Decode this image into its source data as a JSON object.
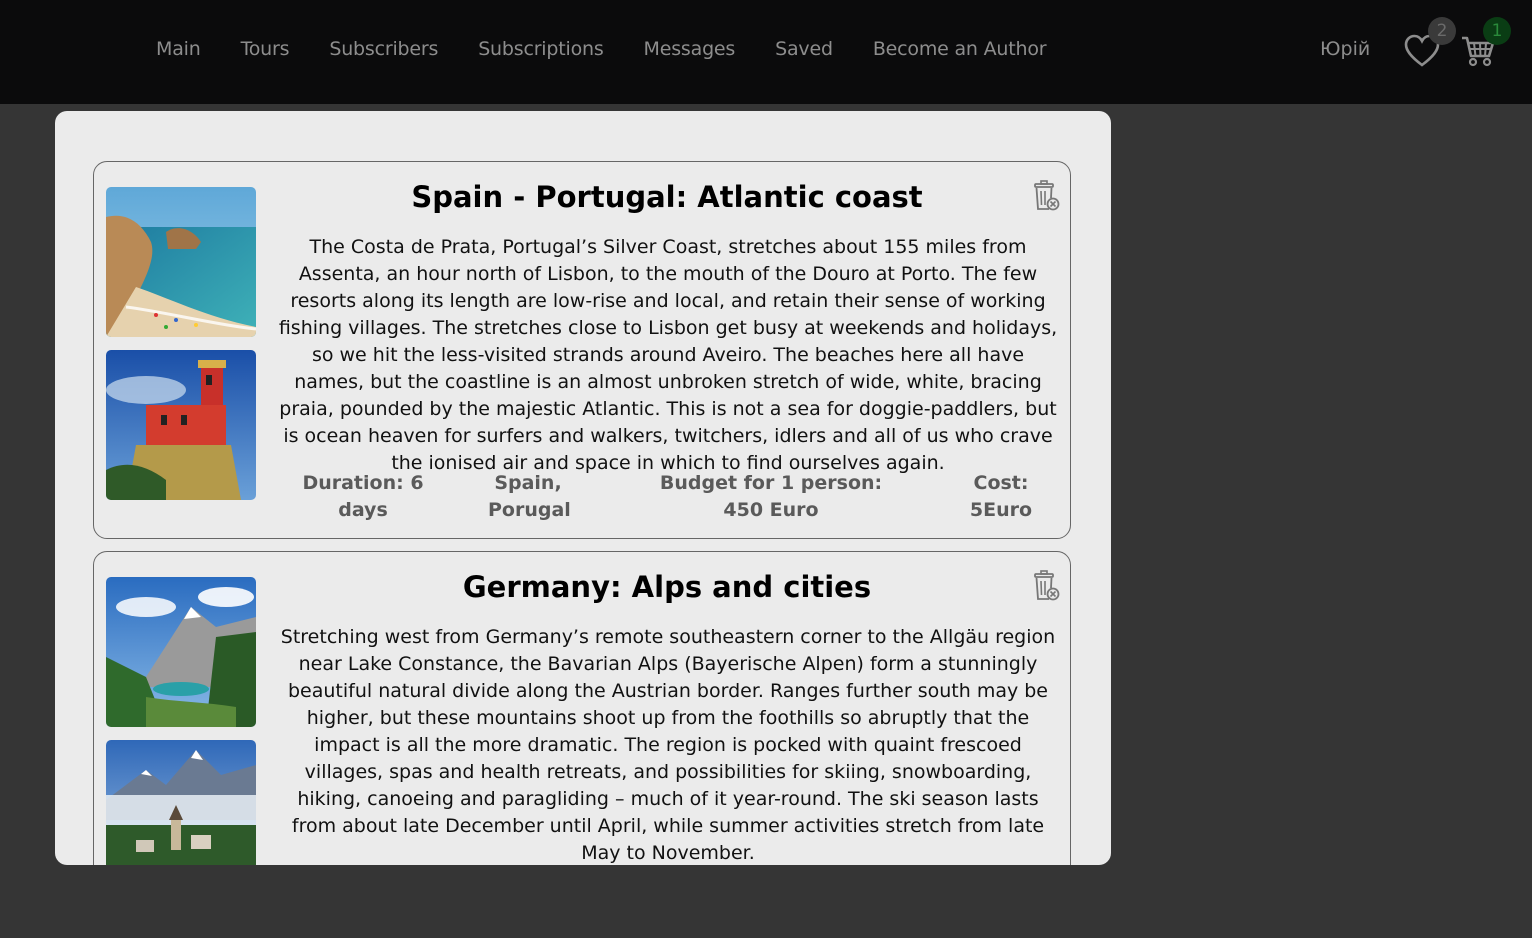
{
  "nav": {
    "links": [
      "Main",
      "Tours",
      "Subscribers",
      "Subscriptions",
      "Messages",
      "Saved",
      "Become an Author"
    ],
    "user": "Юрій",
    "favorites_count": "2",
    "cart_count": "1"
  },
  "tours": [
    {
      "title": "Spain - Portugal: Atlantic coast",
      "description": "The Costa de Prata, Portugal’s Silver Coast, stretches about 155 miles from Assenta, an hour north of Lisbon, to the mouth of the Douro at Porto. The few resorts along its length are low-rise and local, and retain their sense of working fishing villages. The stretches close to Lisbon get busy at weekends and holidays, so we hit the less-visited strands around Aveiro. The beaches here all have names, but the coastline is an almost unbroken stretch of wide, white, bracing praia, pounded by the majestic Atlantic. This is not a sea for doggie-paddlers, but is ocean heaven for surfers and walkers, twitchers, idlers and all of us who crave the ionised air and space in which to find ourselves again.",
      "duration": "Duration: 6 days",
      "countries": "Spain, Porugal",
      "budget": "Budget for 1 person: 450 Euro",
      "cost": "Cost: 5Euro"
    },
    {
      "title": "Germany: Alps and cities",
      "description": "Stretching west from Germany’s remote southeastern corner to the Allgäu region near Lake Constance, the Bavarian Alps (Bayerische Alpen) form a stunningly beautiful natural divide along the Austrian border. Ranges further south may be higher, but these mountains shoot up from the foothills so abruptly that the impact is all the more dramatic. The region is pocked with quaint frescoed villages, spas and health retreats, and possibilities for skiing, snowboarding, hiking, canoeing and paragliding – much of it year-round. The ski season lasts from about late December until April, while summer activities stretch from late May to November."
    }
  ],
  "colors": {
    "navbar": "#0b0b0c",
    "background": "#353535",
    "modal": "#ebebeb",
    "nav_text": "#8d8d8d",
    "cart_badge": "#0a3d14"
  },
  "icons": {
    "favorites": "heart-icon",
    "cart": "cart-icon",
    "delete": "trash-icon"
  }
}
